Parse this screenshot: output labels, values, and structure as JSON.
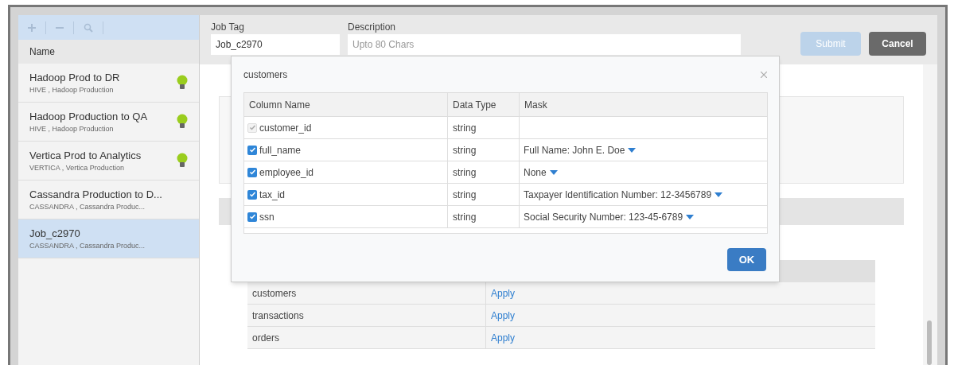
{
  "sidebar": {
    "column_header": "Name",
    "items": [
      {
        "title": "Hadoop Prod to DR",
        "subtitle": "HIVE , Hadoop Production",
        "status_bulb": true,
        "selected": false
      },
      {
        "title": "Hadoop Production to QA",
        "subtitle": "HIVE , Hadoop Production",
        "status_bulb": true,
        "selected": false
      },
      {
        "title": "Vertica Prod to Analytics",
        "subtitle": "VERTICA , Vertica Production",
        "status_bulb": true,
        "selected": false
      },
      {
        "title": "Cassandra Production to D...",
        "subtitle": "CASSANDRA , Cassandra Produc...",
        "status_bulb": false,
        "selected": false
      },
      {
        "title": "Job_c2970",
        "subtitle": "CASSANDRA , Cassandra Produc...",
        "status_bulb": false,
        "selected": true
      }
    ]
  },
  "form": {
    "job_tag": {
      "label": "Job Tag",
      "value": "Job_c2970"
    },
    "description": {
      "label": "Description",
      "placeholder": "Upto 80 Chars"
    },
    "submit": {
      "label": "Submit",
      "disabled": true
    },
    "cancel": {
      "label": "Cancel"
    }
  },
  "tables": {
    "rows": [
      {
        "name": "customers",
        "action": "Apply"
      },
      {
        "name": "transactions",
        "action": "Apply"
      },
      {
        "name": "orders",
        "action": "Apply"
      }
    ]
  },
  "dialog": {
    "title": "customers",
    "columns": [
      "Column Name",
      "Data Type",
      "Mask"
    ],
    "rows": [
      {
        "name": "customer_id",
        "type": "string",
        "checked": true,
        "disabled": true
      },
      {
        "name": "full_name",
        "type": "string",
        "mask": "Full Name: John E. Doe",
        "checked": true,
        "disabled": false
      },
      {
        "name": "employee_id",
        "type": "string",
        "mask": "None",
        "checked": true,
        "disabled": false
      },
      {
        "name": "tax_id",
        "type": "string",
        "mask": "Taxpayer Identification Number: 12-3456789",
        "checked": true,
        "disabled": false
      },
      {
        "name": "ssn",
        "type": "string",
        "mask": "Social Security Number: 123-45-6789",
        "checked": true,
        "disabled": false
      }
    ],
    "ok": "OK"
  }
}
